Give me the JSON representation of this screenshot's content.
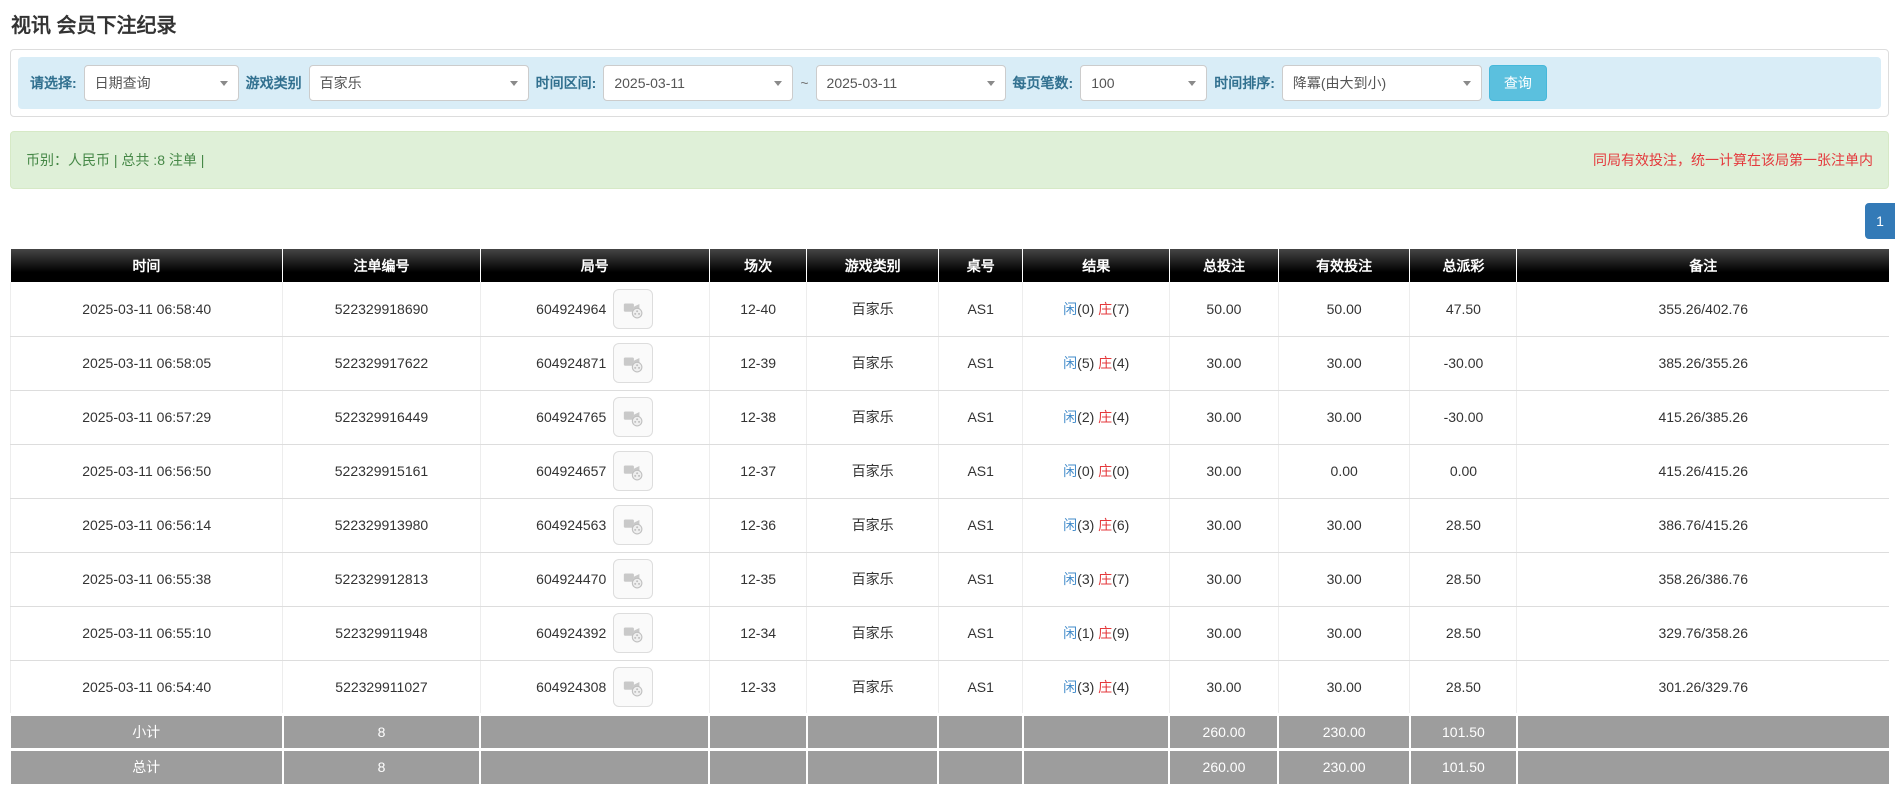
{
  "page": {
    "title": "视讯 会员下注纪录"
  },
  "filters": {
    "query_type_label": "请选择:",
    "query_type_value": "日期查询",
    "game_type_label": "游戏类别",
    "game_type_value": "百家乐",
    "time_range_label": "时间区间:",
    "date_from": "2025-03-11",
    "tilde": "~",
    "date_to": "2025-03-11",
    "page_size_label": "每页笔数:",
    "page_size_value": "100",
    "sort_label": "时间排序:",
    "sort_value": "降冪(由大到小)",
    "search_button": "查询"
  },
  "summary": {
    "left": "币别：人民币 | 总共 :8 注单 |",
    "right_note": "同局有效投注，统一计算在该局第一张注单内"
  },
  "pagination": {
    "current": "1"
  },
  "icons": {
    "dropdown": "chevron-down-icon",
    "video": "video-replay-icon"
  },
  "colors": {
    "filter_bar_bg": "#d9edf7",
    "filter_label": "#31708f",
    "search_button_bg": "#5bc0de",
    "summary_bg": "#dff0d8",
    "summary_text": "#468847",
    "note_red": "#e4393c",
    "link_blue": "#337ab7",
    "player_blue": "#428bca",
    "banker_red": "#e4393c",
    "header_bg": "#000000",
    "footer_bg": "#9d9d9d"
  },
  "table": {
    "headers": [
      "时间",
      "注单编号",
      "局号",
      "场次",
      "游戏类别",
      "桌号",
      "结果",
      "总投注",
      "有效投注",
      "总派彩",
      "备注"
    ],
    "rows": [
      {
        "time": "2025-03-11 06:58:40",
        "bet_id": "522329918690",
        "round_id": "604924964",
        "session": "12-40",
        "game": "百家乐",
        "table_no": "AS1",
        "player_label": "闲",
        "player_score": "(0)",
        "banker_label": "庄",
        "banker_score": "(7)",
        "total_bet": "50.00",
        "valid_bet": "50.00",
        "payout": "47.50",
        "remark": "355.26/402.76"
      },
      {
        "time": "2025-03-11 06:58:05",
        "bet_id": "522329917622",
        "round_id": "604924871",
        "session": "12-39",
        "game": "百家乐",
        "table_no": "AS1",
        "player_label": "闲",
        "player_score": "(5)",
        "banker_label": "庄",
        "banker_score": "(4)",
        "total_bet": "30.00",
        "valid_bet": "30.00",
        "payout": "-30.00",
        "remark": "385.26/355.26"
      },
      {
        "time": "2025-03-11 06:57:29",
        "bet_id": "522329916449",
        "round_id": "604924765",
        "session": "12-38",
        "game": "百家乐",
        "table_no": "AS1",
        "player_label": "闲",
        "player_score": "(2)",
        "banker_label": "庄",
        "banker_score": "(4)",
        "total_bet": "30.00",
        "valid_bet": "30.00",
        "payout": "-30.00",
        "remark": "415.26/385.26"
      },
      {
        "time": "2025-03-11 06:56:50",
        "bet_id": "522329915161",
        "round_id": "604924657",
        "session": "12-37",
        "game": "百家乐",
        "table_no": "AS1",
        "player_label": "闲",
        "player_score": "(0)",
        "banker_label": "庄",
        "banker_score": "(0)",
        "total_bet": "30.00",
        "valid_bet": "0.00",
        "payout": "0.00",
        "remark": "415.26/415.26"
      },
      {
        "time": "2025-03-11 06:56:14",
        "bet_id": "522329913980",
        "round_id": "604924563",
        "session": "12-36",
        "game": "百家乐",
        "table_no": "AS1",
        "player_label": "闲",
        "player_score": "(3)",
        "banker_label": "庄",
        "banker_score": "(6)",
        "total_bet": "30.00",
        "valid_bet": "30.00",
        "payout": "28.50",
        "remark": "386.76/415.26"
      },
      {
        "time": "2025-03-11 06:55:38",
        "bet_id": "522329912813",
        "round_id": "604924470",
        "session": "12-35",
        "game": "百家乐",
        "table_no": "AS1",
        "player_label": "闲",
        "player_score": "(3)",
        "banker_label": "庄",
        "banker_score": "(7)",
        "total_bet": "30.00",
        "valid_bet": "30.00",
        "payout": "28.50",
        "remark": "358.26/386.76"
      },
      {
        "time": "2025-03-11 06:55:10",
        "bet_id": "522329911948",
        "round_id": "604924392",
        "session": "12-34",
        "game": "百家乐",
        "table_no": "AS1",
        "player_label": "闲",
        "player_score": "(1)",
        "banker_label": "庄",
        "banker_score": "(9)",
        "total_bet": "30.00",
        "valid_bet": "30.00",
        "payout": "28.50",
        "remark": "329.76/358.26"
      },
      {
        "time": "2025-03-11 06:54:40",
        "bet_id": "522329911027",
        "round_id": "604924308",
        "session": "12-33",
        "game": "百家乐",
        "table_no": "AS1",
        "player_label": "闲",
        "player_score": "(3)",
        "banker_label": "庄",
        "banker_score": "(4)",
        "total_bet": "30.00",
        "valid_bet": "30.00",
        "payout": "28.50",
        "remark": "301.26/329.76"
      }
    ],
    "subtotal": {
      "label": "小计",
      "count": "8",
      "total_bet": "260.00",
      "valid_bet": "230.00",
      "payout": "101.50"
    },
    "total": {
      "label": "总计",
      "count": "8",
      "total_bet": "260.00",
      "valid_bet": "230.00",
      "payout": "101.50"
    }
  }
}
